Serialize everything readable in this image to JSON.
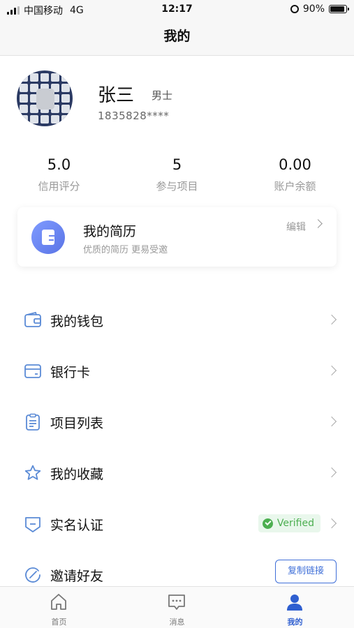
{
  "status_bar": {
    "carrier": "中国移动",
    "network": "4G",
    "time": "12:17",
    "battery": "90%"
  },
  "nav": {
    "title": "我的"
  },
  "profile": {
    "name": "张三",
    "gender": "男士",
    "phone": "1835828****"
  },
  "stats": [
    {
      "value": "5.0",
      "label": "信用评分"
    },
    {
      "value": "5",
      "label": "参与项目"
    },
    {
      "value": "0.00",
      "label": "账户余额"
    }
  ],
  "resume_card": {
    "title": "我的简历",
    "subtitle": "优质的简历 更易受邀",
    "edit_label": "编辑",
    "icon": "document-icon"
  },
  "menu": [
    {
      "label": "我的钱包",
      "icon": "wallet-icon"
    },
    {
      "label": "银行卡",
      "icon": "bank-card-icon"
    },
    {
      "label": "项目列表",
      "icon": "clipboard-icon"
    },
    {
      "label": "我的收藏",
      "icon": "star-icon"
    },
    {
      "label": "实名认证",
      "icon": "shield-icon",
      "badge": "Verified"
    },
    {
      "label": "邀请好友",
      "icon": "invite-icon",
      "button": "复制链接"
    }
  ],
  "tabs": [
    {
      "label": "首页",
      "icon": "home-icon",
      "active": false
    },
    {
      "label": "消息",
      "icon": "message-icon",
      "active": false
    },
    {
      "label": "我的",
      "icon": "user-icon",
      "active": true
    }
  ],
  "colors": {
    "accent": "#2f5fd0",
    "verified_green": "#4caf50",
    "icon_blue": "#5b8bd6"
  }
}
